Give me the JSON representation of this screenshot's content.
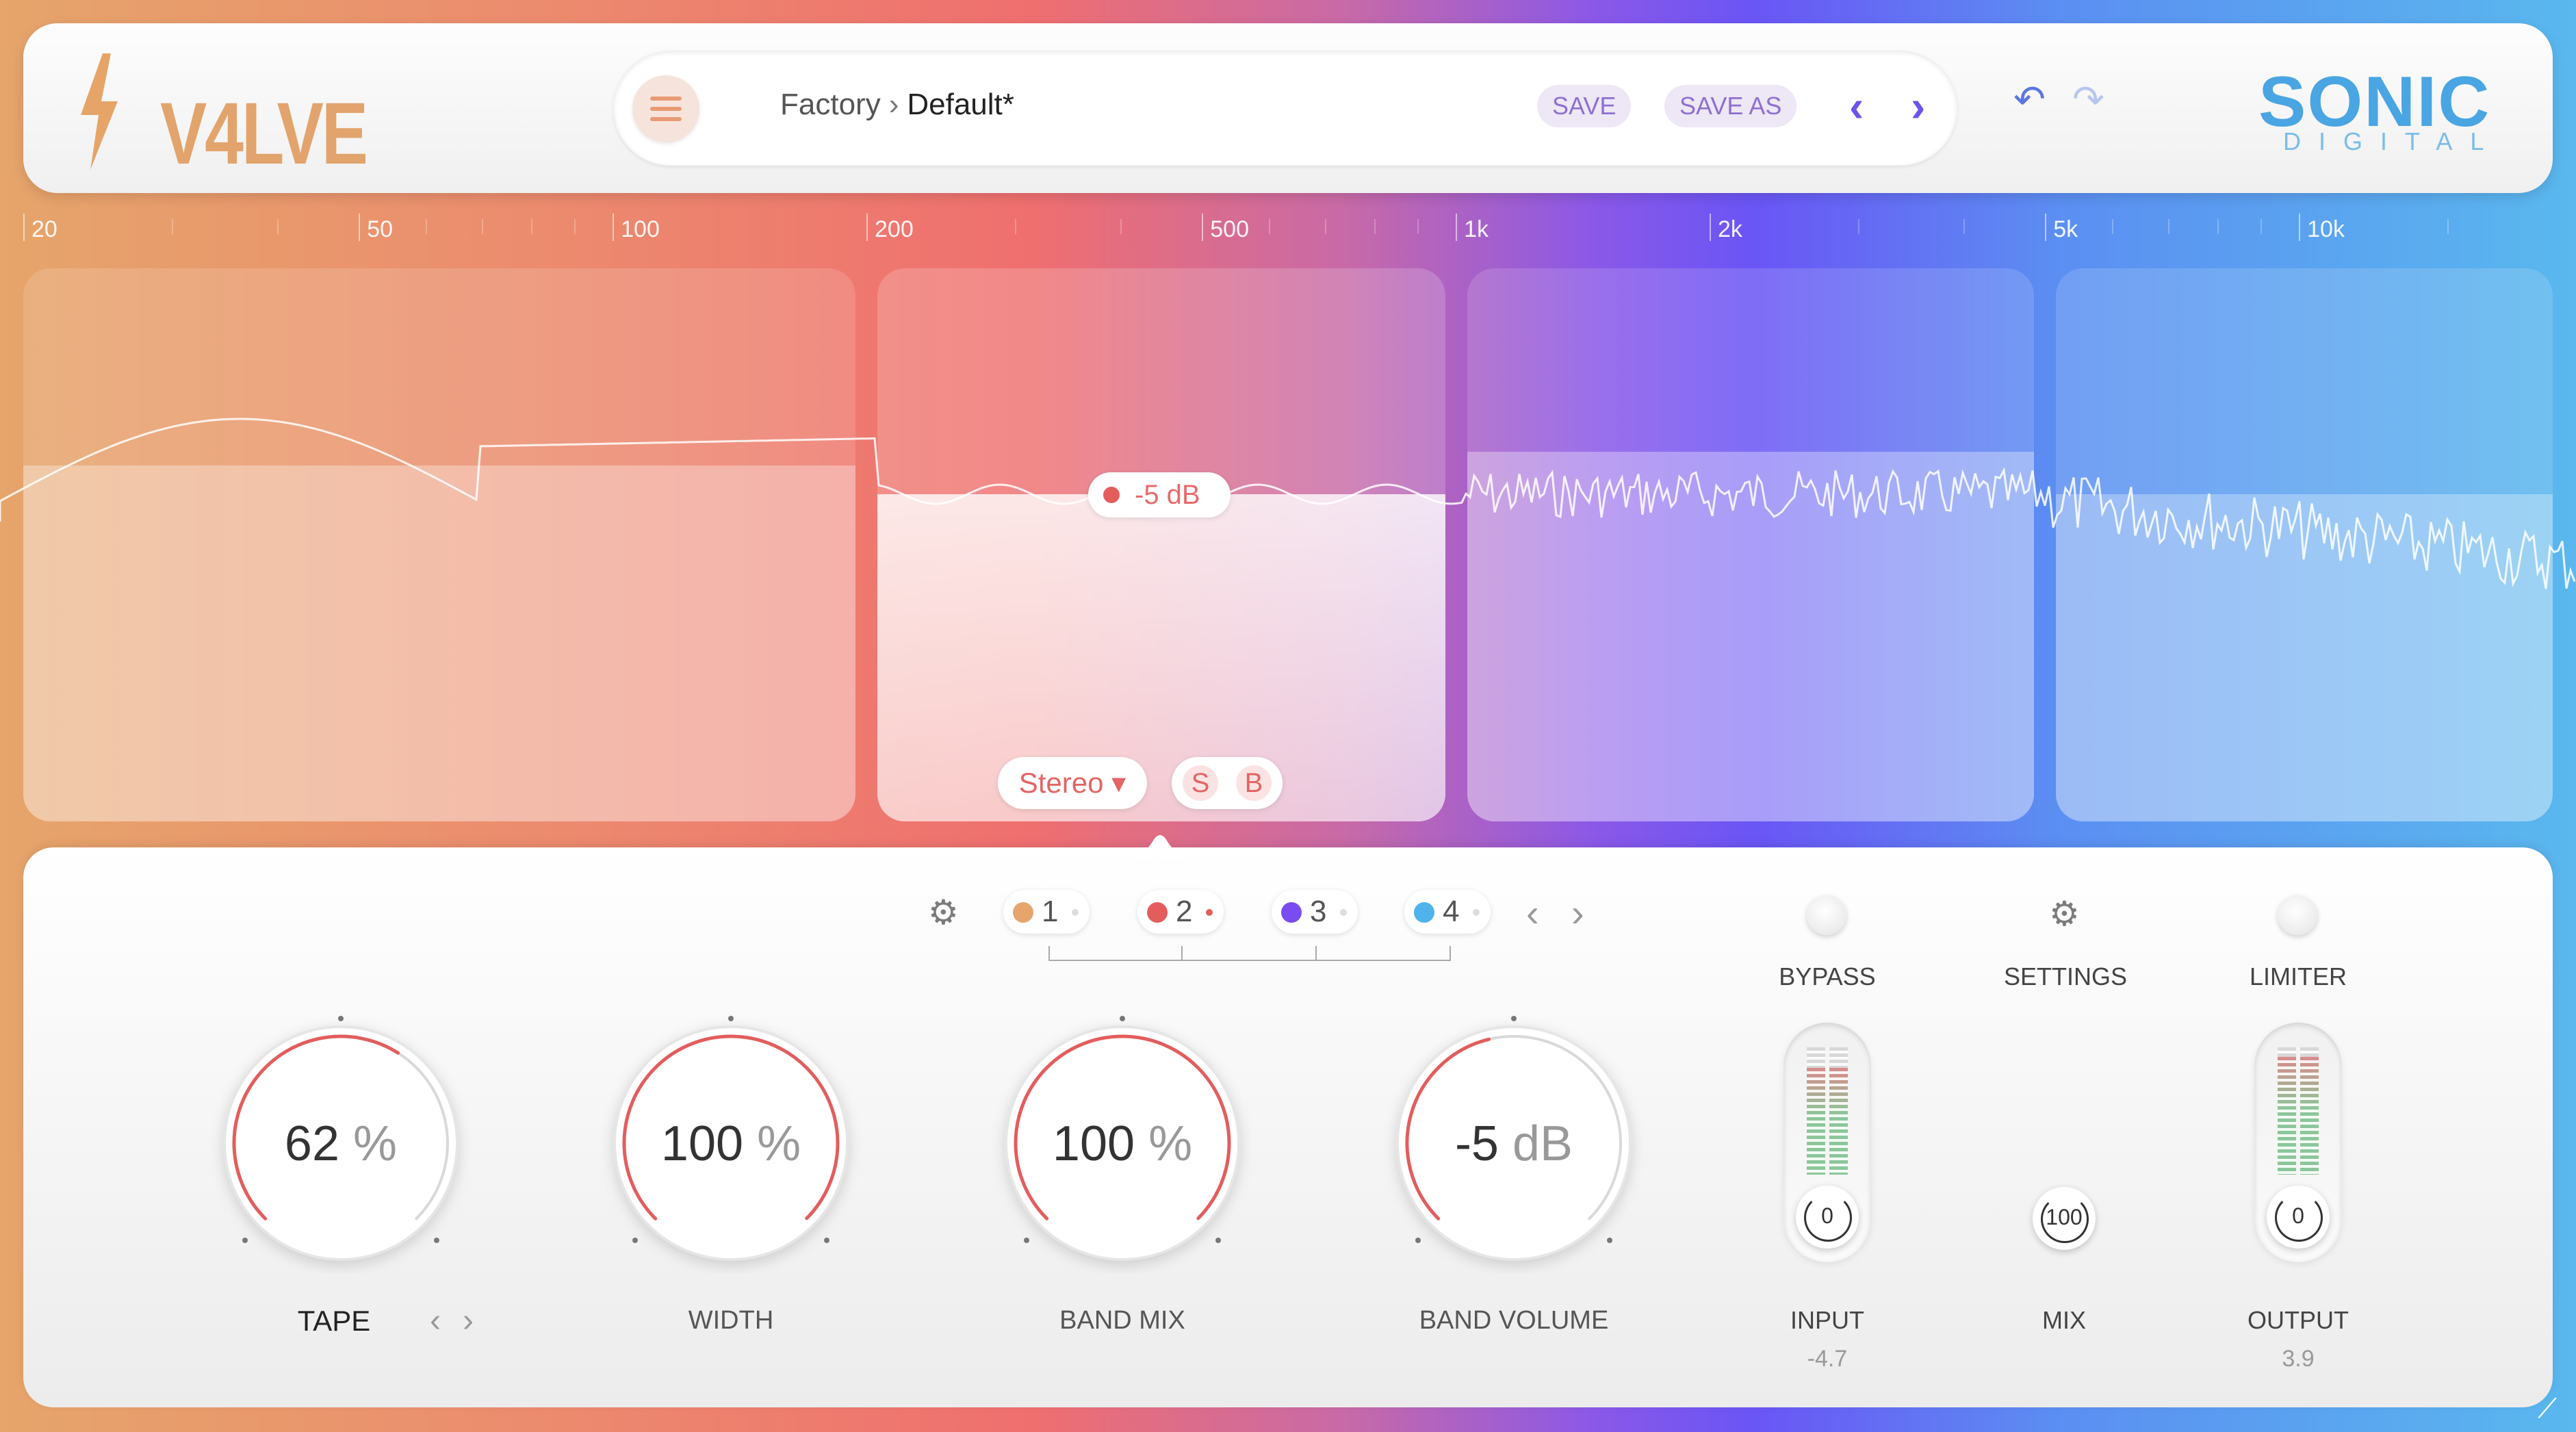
{
  "header": {
    "app_name": "V4LVE",
    "menu_icon": "hamburger-icon",
    "preset_folder": "Factory",
    "preset_separator": "›",
    "preset_name": "Default*",
    "save_label": "SAVE",
    "save_as_label": "SAVE AS",
    "prev_icon": "‹",
    "next_icon": "›",
    "undo_icon": "↶",
    "redo_icon": "↷",
    "brand_name": "SONIC",
    "brand_sub": "DIGITAL"
  },
  "ruler": {
    "labels": [
      "20",
      "50",
      "100",
      "200",
      "500",
      "1k",
      "2k",
      "5k",
      "10k"
    ]
  },
  "bands_view": {
    "selected_band_gain": "-5 dB",
    "channel_mode": "Stereo ▾",
    "solo_label": "S",
    "bypass_label": "B"
  },
  "band_tabs": [
    {
      "num": "1",
      "color": "#e7a56e"
    },
    {
      "num": "2",
      "color": "#e45d5d"
    },
    {
      "num": "3",
      "color": "#7a4cf0"
    },
    {
      "num": "4",
      "color": "#4fb3ec"
    }
  ],
  "controls": {
    "tape": {
      "value": "62",
      "unit": "%",
      "label": "TAPE",
      "level": 0.62
    },
    "width": {
      "value": "100",
      "unit": "%",
      "label": "WIDTH",
      "level": 1.0
    },
    "band_mix": {
      "value": "100",
      "unit": "%",
      "label": "BAND MIX",
      "level": 1.0
    },
    "band_volume": {
      "value": "-5",
      "unit": "dB",
      "label": "BAND VOLUME",
      "level": 0.45
    }
  },
  "right": {
    "bypass_label": "BYPASS",
    "settings_label": "SETTINGS",
    "limiter_label": "LIMITER",
    "input_label": "INPUT",
    "input_knob": "0",
    "input_value": "-4.7",
    "mix_label": "MIX",
    "mix_knob": "100",
    "output_label": "OUTPUT",
    "output_knob": "0",
    "output_value": "3.9"
  },
  "colors": {
    "accent_red": "#e45d5d",
    "accent_purple": "#7a4cf0",
    "accent_blue": "#4fb3ec",
    "accent_orange": "#e7a56e"
  }
}
